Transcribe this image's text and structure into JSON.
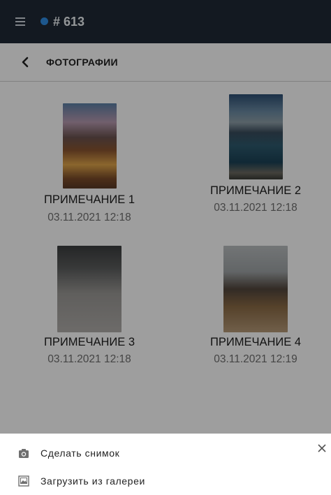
{
  "topbar": {
    "title": "# 613",
    "status_color": "#2f8de4",
    "menu_icon": "hamburger-menu-icon"
  },
  "subheader": {
    "back_icon": "chevron-left-icon",
    "title": "ФОТОГРАФИИ"
  },
  "photos": [
    {
      "caption": "ПРИМЕЧАНИЕ 1",
      "date": "03.11.2021 12:18"
    },
    {
      "caption": "ПРИМЕЧАНИЕ 2",
      "date": "03.11.2021 12:18"
    },
    {
      "caption": "ПРИМЕЧАНИЕ 3",
      "date": "03.11.2021 12:18"
    },
    {
      "caption": "ПРИМЕЧАНИЕ 4",
      "date": "03.11.2021 12:19"
    }
  ],
  "sheet": {
    "take_photo_label": "Сделать снимок",
    "gallery_label": "Загрузить из галереи",
    "take_photo_icon": "camera-icon",
    "gallery_icon": "image-gallery-icon",
    "close_icon": "close-icon"
  }
}
